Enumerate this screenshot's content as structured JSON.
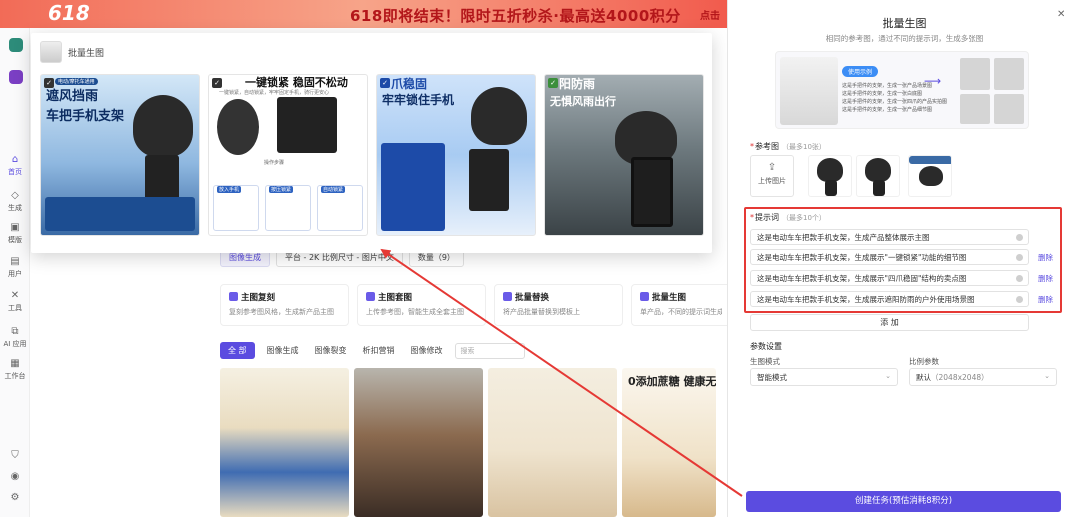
{
  "banner": {
    "badge": "618",
    "headline": "618即将结束！限时五折秒杀·最高送4000积分",
    "cta": "点击"
  },
  "rail": {
    "items": [
      {
        "label": "首页",
        "icon": "home-icon"
      },
      {
        "label": "生成",
        "icon": "diamond-icon"
      },
      {
        "label": "模版",
        "icon": "template-icon"
      },
      {
        "label": "用户",
        "icon": "user-icon"
      },
      {
        "label": "工具",
        "icon": "tool-icon"
      },
      {
        "label": "AI 应用",
        "icon": "ai-app-icon"
      },
      {
        "label": "工作台",
        "icon": "workspace-icon"
      }
    ]
  },
  "filter_bar": {
    "mode": "图像生成",
    "platform": "平台 - 2K 比例尺寸 - 图片中文",
    "count": "数量（9）"
  },
  "tool_cards": [
    {
      "title": "主图复刻",
      "desc": "复刻参考图风格，生成新产品主图"
    },
    {
      "title": "主图套图",
      "desc": "上传参考图，智能生成全套主图"
    },
    {
      "title": "批量替换",
      "desc": "将产品批量替换到模板上"
    },
    {
      "title": "批量生图",
      "desc": "单产品，不同的提示词生成多张图"
    }
  ],
  "category_tabs": [
    {
      "label": "全 部",
      "active": true
    },
    {
      "label": "图像生成",
      "active": false
    },
    {
      "label": "图像裂变",
      "active": false
    },
    {
      "label": "析扣营销",
      "active": false
    },
    {
      "label": "图像修改",
      "active": false
    }
  ],
  "category_search": {
    "placeholder": "搜索"
  },
  "gallery": {
    "card4_title": "0添加蔗糖 健康无"
  },
  "popup": {
    "title": "批量生图",
    "results": [
      {
        "tag": "电动/摩托车通用",
        "headline1": "遮风挡雨",
        "headline2": "车把手机支架"
      },
      {
        "headline1": "一键锁紧 稳固不松动",
        "sub": "一键锁紧，自动锁紧，牢牢固定手机，骑行更安心",
        "step": "操作步骤",
        "chips": [
          "放入手机",
          "按压锁紧",
          "自动锁紧"
        ]
      },
      {
        "headline1": "爪稳固",
        "headline2": "牢牢锁住手机"
      },
      {
        "headline1": "阳防雨",
        "headline2": "无惧风雨出行"
      }
    ]
  },
  "panel": {
    "title": "批量生图",
    "subtitle": "相同的参考图，通过不同的提示词，生成多张图",
    "demo": {
      "pill": "使用示例",
      "lines": [
        "这是手把件的支架，生成一张产品场景图",
        "这是手把件的支架，生成一张白底图",
        "这是手把件的支架，生成一张四爪的产品实拍图",
        "这是手把件的支架，生成一张产品细节图"
      ]
    },
    "ref_label": "参考图",
    "ref_hint": "（最多10张）",
    "upload_label": "上传图片",
    "prompt_label": "提示词",
    "prompt_hint": "（最多10个）",
    "prompts": [
      "这是电动车车把款手机支架，生成产品整体展示主图",
      "这是电动车车把款手机支架，生成展示\"一键锁紧\"功能的细节图",
      "这是电动车车把款手机支架，生成展示\"四爪稳固\"结构的卖点图",
      "这是电动车车把款手机支架，生成展示遮阳防雨的户外使用场景图"
    ],
    "delete_label": "删除",
    "add_label": "添 加",
    "params_label": "参数设置",
    "mode_label": "生图模式",
    "mode_value": "智能模式",
    "ratio_label": "比例参数",
    "ratio_value": "默认",
    "ratio_sub": "（2048x2048）",
    "submit_label": "创建任务(预估消耗8积分)",
    "close_icon": "close-icon"
  },
  "colors": {
    "accent": "#5b4ce0",
    "highlight": "#e53935"
  }
}
